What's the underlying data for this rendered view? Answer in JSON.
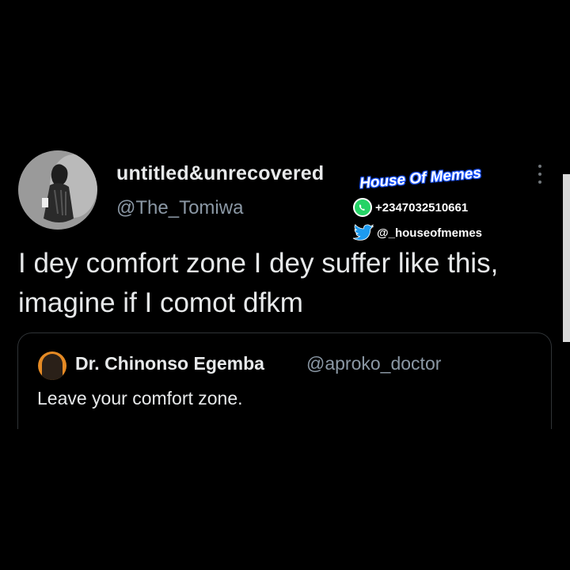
{
  "tweet": {
    "display_name": "untitled&unrecovered",
    "handle": "@The_Tomiwa",
    "text": "I dey comfort zone I dey suffer like this, imagine if I comot dfkm",
    "more_icon": "more-vertical-icon"
  },
  "quoted_tweet": {
    "display_name": "Dr. Chinonso Egemba",
    "handle": "@aproko_doctor",
    "text": "Leave your comfort zone."
  },
  "watermark": {
    "title": "House Of Memes",
    "phone": "+2347032510661",
    "twitter": "@_houseofmemes",
    "phone_icon": "whatsapp-icon",
    "twitter_icon": "twitter-bird-icon"
  },
  "colors": {
    "background": "#000000",
    "primary_text": "#e7e9ea",
    "secondary_text": "#8b98a5",
    "border": "#2f3336",
    "whatsapp_green": "#25d366",
    "twitter_blue": "#1d9bf0",
    "watermark_outline": "#1a55ff"
  }
}
